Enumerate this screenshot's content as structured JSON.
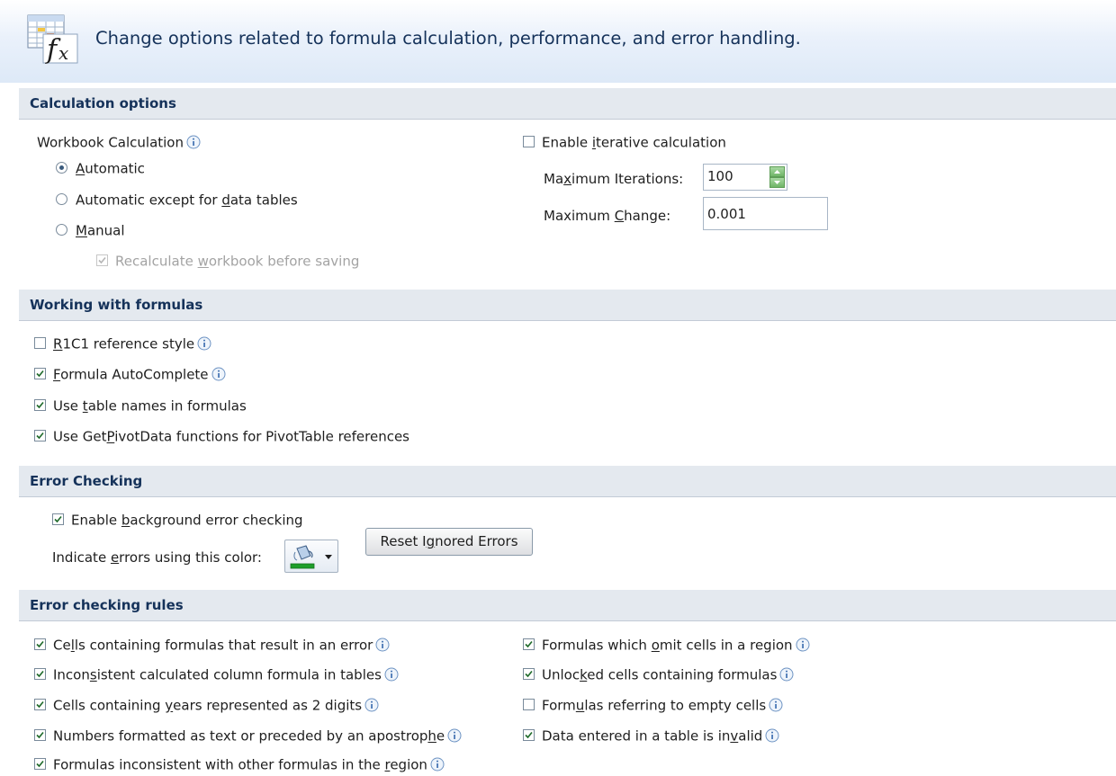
{
  "header": {
    "description": "Change options related to formula calculation, performance, and error handling."
  },
  "sections": {
    "calculation": "Calculation options",
    "formulas": "Working with formulas",
    "error_checking": "Error Checking",
    "rules": "Error checking rules"
  },
  "calculation": {
    "workbook_label": "Workbook Calculation",
    "mode_options": [
      {
        "pre": "",
        "key": "A",
        "post": "utomatic",
        "selected": true
      },
      {
        "pre": "Automatic except for ",
        "key": "d",
        "post": "ata tables",
        "selected": false
      },
      {
        "pre": "",
        "key": "M",
        "post": "anual",
        "selected": false
      }
    ],
    "recalc_before_saving": {
      "pre": "Recalculate ",
      "key": "w",
      "post": "orkbook before saving",
      "checked": true,
      "enabled": false
    },
    "iterative": {
      "pre": "Enable ",
      "key": "i",
      "post": "terative calculation",
      "checked": false
    },
    "max_iterations": {
      "pre": "Ma",
      "key": "x",
      "post": "imum Iterations:",
      "value": "100"
    },
    "max_change": {
      "pre": "Maximum ",
      "key": "C",
      "post": "hange:",
      "value": "0.001"
    }
  },
  "formulas": [
    {
      "pre": "",
      "key": "R",
      "post": "1C1 reference style",
      "checked": false,
      "info": true
    },
    {
      "pre": "",
      "key": "F",
      "post": "ormula AutoComplete",
      "checked": true,
      "info": true
    },
    {
      "pre": "Use ",
      "key": "t",
      "post": "able names in formulas",
      "checked": true,
      "info": false
    },
    {
      "pre": "Use Get",
      "key": "P",
      "post": "ivotData functions for PivotTable references",
      "checked": true,
      "info": false
    }
  ],
  "error_checking": {
    "enable_bg": {
      "pre": "Enable ",
      "key": "b",
      "post": "ackground error checking",
      "checked": true
    },
    "color_label": {
      "pre": "Indicate ",
      "key": "e",
      "post": "rrors using this color:"
    },
    "reset_button": {
      "pre": "Reset I",
      "key": "g",
      "post": "nored Errors"
    },
    "color_accent": "#1e9e2a"
  },
  "rules_left": [
    {
      "pre": "Ce",
      "key": "l",
      "post": "ls containing formulas that result in an error",
      "checked": true
    },
    {
      "pre": "Incon",
      "key": "s",
      "post": "istent calculated column formula in tables",
      "checked": true
    },
    {
      "pre": "Cells containing ",
      "key": "y",
      "post": "ears represented as 2 digits",
      "checked": true
    },
    {
      "pre": "Numbers formatted as text or preceded by an apostrop",
      "key": "h",
      "post": "e",
      "checked": true
    },
    {
      "pre": "Formulas inconsistent with other formulas in the ",
      "key": "r",
      "post": "egion",
      "checked": true
    }
  ],
  "rules_right": [
    {
      "pre": "Formulas which ",
      "key": "o",
      "post": "mit cells in a region",
      "checked": true
    },
    {
      "pre": "Unloc",
      "key": "k",
      "post": "ed cells containing formulas",
      "checked": true
    },
    {
      "pre": "Form",
      "key": "u",
      "post": "las referring to empty cells",
      "checked": false
    },
    {
      "pre": "Data entered in a table is in",
      "key": "v",
      "post": "alid",
      "checked": true
    }
  ],
  "icons": {
    "header": "formula-fx-icon",
    "info": "info-icon",
    "paint_bucket": "paint-bucket-icon",
    "dropdown": "chevron-down-icon",
    "spin": "spin-arrows-icon"
  }
}
